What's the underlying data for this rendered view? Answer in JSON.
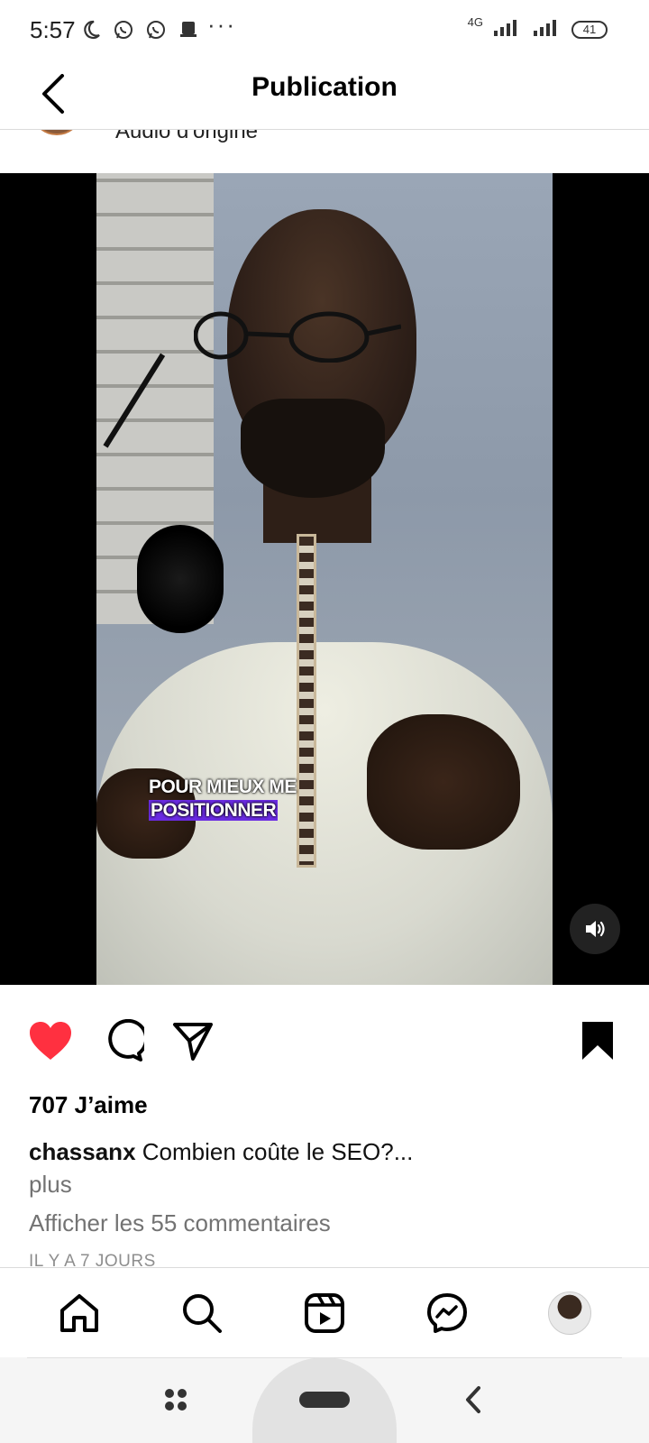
{
  "status_bar": {
    "time": "5:57",
    "overflow": "···",
    "network": "4G",
    "battery": "41",
    "left_icons": [
      "moon-icon",
      "whatsapp-icon",
      "whatsapp-icon",
      "notification-icon"
    ]
  },
  "header": {
    "title": "Publication",
    "back_icon": "chevron-left-icon"
  },
  "author": {
    "audio_label": "Audio d'origine"
  },
  "video": {
    "caption_line1": "POUR MIEUX ME",
    "caption_line2": "POSITIONNER",
    "caption_highlight_color": "#6a2be2",
    "mute_icon": "speaker-on-icon"
  },
  "actions": {
    "like_icon": "heart-filled-icon",
    "like_color": "#ff3040",
    "comment_icon": "comment-icon",
    "share_icon": "send-icon",
    "save_icon": "bookmark-filled-icon"
  },
  "post": {
    "likes": "707 J’aime",
    "username": "chassanx",
    "caption": "Combien coûte le SEO?...",
    "more": "plus",
    "view_comments": "Afficher les 55 commentaires",
    "time_ago": "IL Y A 7 JOURS"
  },
  "bottom_nav": {
    "items": [
      "home-icon",
      "search-icon",
      "reels-icon",
      "messenger-icon",
      "profile-avatar"
    ]
  },
  "system_nav": {
    "items": [
      "recents-icon",
      "home-pill",
      "back-icon"
    ]
  }
}
